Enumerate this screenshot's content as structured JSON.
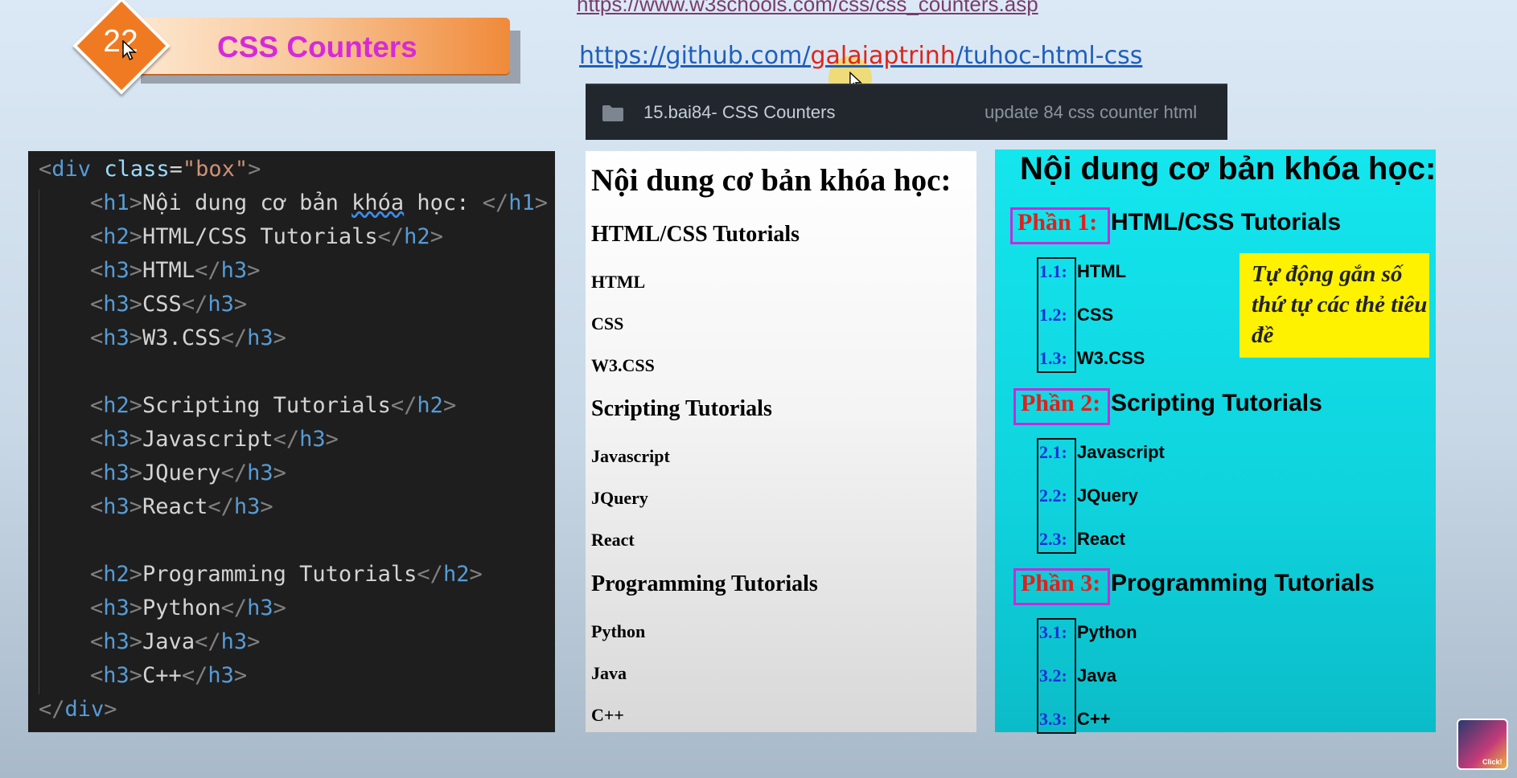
{
  "lesson": {
    "number": "22",
    "title": "CSS Counters"
  },
  "links": {
    "w3schools": "https://www.w3schools.com/css/css_counters.asp",
    "github_prefix": "https://github.com/",
    "github_user": "galaiaptrinh",
    "github_suffix": "/tuhoc-html-css"
  },
  "github_row": {
    "folder_icon": "folder-icon",
    "folder_name": "15.bai84- CSS Counters",
    "commit_message": "update 84 css counter html"
  },
  "code": {
    "open_tag": "div",
    "attr_name": "class",
    "attr_value": "\"box\"",
    "lines": [
      {
        "tag": "h1",
        "text": "Nội dung cơ bản ",
        "squiggle": "khóa",
        "tail": " học: "
      },
      {
        "tag": "h2",
        "text": "HTML/CSS Tutorials"
      },
      {
        "tag": "h3",
        "text": "HTML"
      },
      {
        "tag": "h3",
        "text": "CSS"
      },
      {
        "tag": "h3",
        "text": "W3.CSS"
      },
      {
        "tag": "h2",
        "text": "Scripting Tutorials"
      },
      {
        "tag": "h3",
        "text": "Javascript"
      },
      {
        "tag": "h3",
        "text": "JQuery"
      },
      {
        "tag": "h3",
        "text": "React"
      },
      {
        "tag": "h2",
        "text": "Programming Tutorials"
      },
      {
        "tag": "h3",
        "text": "Python"
      },
      {
        "tag": "h3",
        "text": "Java"
      },
      {
        "tag": "h3",
        "text": "C++"
      }
    ],
    "close_tag": "div"
  },
  "preview_plain": {
    "title": "Nội dung cơ bản khóa học:",
    "sections": [
      {
        "heading": "HTML/CSS Tutorials",
        "items": [
          "HTML",
          "CSS",
          "W3.CSS"
        ]
      },
      {
        "heading": "Scripting Tutorials",
        "items": [
          "Javascript",
          "JQuery",
          "React"
        ]
      },
      {
        "heading": "Programming Tutorials",
        "items": [
          "Python",
          "Java",
          "C++"
        ]
      }
    ]
  },
  "preview_styled": {
    "title": "Nội dung cơ bản khóa học:",
    "sections": [
      {
        "part": "Phần 1:",
        "heading": "HTML/CSS Tutorials",
        "items": [
          {
            "num": "1.1:",
            "text": "HTML"
          },
          {
            "num": "1.2:",
            "text": "CSS"
          },
          {
            "num": "1.3:",
            "text": "W3.CSS"
          }
        ]
      },
      {
        "part": "Phần 2:",
        "heading": "Scripting Tutorials",
        "items": [
          {
            "num": "2.1:",
            "text": "Javascript"
          },
          {
            "num": "2.2:",
            "text": "JQuery"
          },
          {
            "num": "2.3:",
            "text": "React"
          }
        ]
      },
      {
        "part": "Phần 3:",
        "heading": "Programming Tutorials",
        "items": [
          {
            "num": "3.1:",
            "text": "Python"
          },
          {
            "num": "3.2:",
            "text": "Java"
          },
          {
            "num": "3.3:",
            "text": "C++"
          }
        ]
      }
    ],
    "note": "Tự động gắn số thứ tự các thẻ tiêu đề"
  },
  "avatar": {
    "label": "Click!",
    "icon": "channel-avatar-icon"
  },
  "colors": {
    "badge_orange": "#f07a22",
    "badge_title": "#d62ad8",
    "preview_cyan": "#14e6ee",
    "part_border": "#c52bdb",
    "part_text": "#e0201c",
    "num_text": "#1a2fd8",
    "note_bg": "#fff200"
  }
}
